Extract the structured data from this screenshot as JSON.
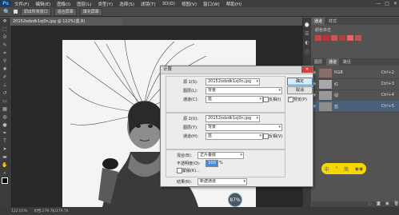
{
  "menu": {
    "logo": "Ps",
    "items": [
      "文件(F)",
      "编辑(E)",
      "图像(I)",
      "图层(L)",
      "类型(Y)",
      "选择(S)",
      "滤镜(T)",
      "3D(D)",
      "视图(V)",
      "窗口(W)",
      "帮助(H)"
    ],
    "window_controls": [
      "—",
      "□",
      "✕"
    ]
  },
  "options": {
    "btn1": "调出所有窗口",
    "btn2": "适合屏幕",
    "btn3": "填充屏幕"
  },
  "document": {
    "tab_title": "20152odzdk1xj0n.jpg @ 122%(蓝,8)",
    "zoom": "122.01%",
    "doc_info": "文档:279.7K/279.7K"
  },
  "panel": {
    "tabs": [
      "通道",
      "样式"
    ],
    "sub_label": "颜色单击",
    "lower_tabs": [
      "图层",
      "通道",
      "路径"
    ],
    "channels": [
      {
        "name": "RGB",
        "shortcut": "Ctrl+2"
      },
      {
        "name": "红",
        "shortcut": "Ctrl+3"
      },
      {
        "name": "绿",
        "shortcut": "Ctrl+4"
      },
      {
        "name": "蓝",
        "shortcut": "Ctrl+5"
      }
    ]
  },
  "dialog": {
    "title": "计算",
    "source1_label": "源 1(S):",
    "source1_file": "20152odzdk1xj0n.jpg",
    "layer1_label": "图层(L):",
    "layer1_value": "背景",
    "channel1_label": "通道(C):",
    "channel1_value": "蓝",
    "invert1_label": "反相(I)",
    "source2_label": "源 2(U):",
    "source2_file": "20152odzdk1xj0n.jpg",
    "layer2_label": "图层(Y):",
    "layer2_value": "背景",
    "channel2_label": "通道(H):",
    "channel2_value": "蓝",
    "invert2_label": "反相(V)",
    "blend_label": "混合(B):",
    "blend_value": "正片叠底",
    "opacity_label": "不透明度(O):",
    "opacity_value": "100",
    "opacity_unit": "%",
    "mask_label": "蒙版(K)...",
    "result_label": "结果(R):",
    "result_value": "新建通道",
    "ok": "确定",
    "cancel": "取消",
    "preview_label": "预览(P)"
  },
  "overlay": {
    "percent": "87%",
    "ime_items": [
      "中",
      "°",
      "简",
      "◉◉"
    ]
  }
}
